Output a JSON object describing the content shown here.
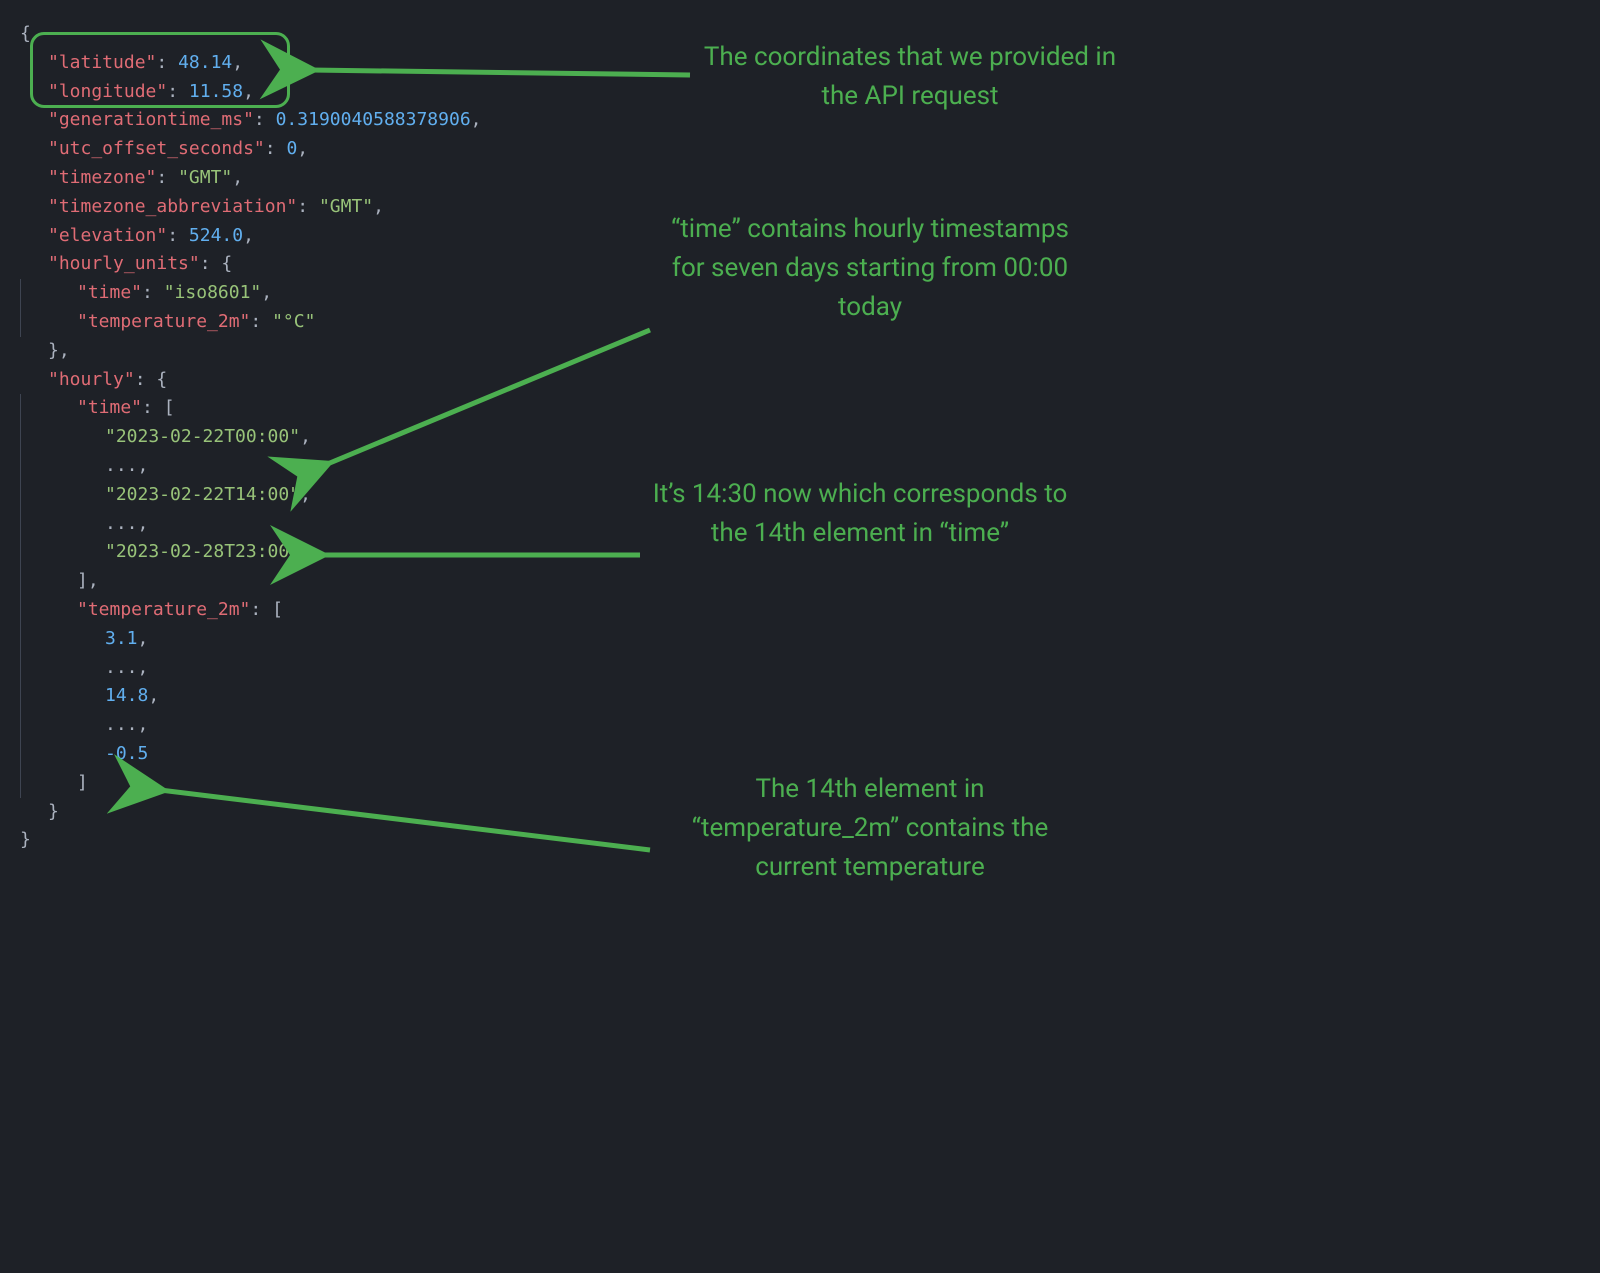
{
  "code": {
    "latitude_key": "\"latitude\"",
    "latitude_val": "48.14",
    "longitude_key": "\"longitude\"",
    "longitude_val": "11.58",
    "gentime_key": "\"generationtime_ms\"",
    "gentime_val": "0.3190040588378906",
    "utc_key": "\"utc_offset_seconds\"",
    "utc_val": "0",
    "tz_key": "\"timezone\"",
    "tz_val": "\"GMT\"",
    "tzabbr_key": "\"timezone_abbreviation\"",
    "tzabbr_val": "\"GMT\"",
    "elev_key": "\"elevation\"",
    "elev_val": "524.0",
    "hourly_units_key": "\"hourly_units\"",
    "hu_time_key": "\"time\"",
    "hu_time_val": "\"iso8601\"",
    "hu_temp_key": "\"temperature_2m\"",
    "hu_temp_val": "\"°C\"",
    "hourly_key": "\"hourly\"",
    "time_key": "\"time\"",
    "time_0": "\"2023-02-22T00:00\"",
    "ellipsis": "...",
    "time_14": "\"2023-02-22T14:00\"",
    "time_last": "\"2023-02-28T23:00\"",
    "temp_key": "\"temperature_2m\"",
    "temp_0": "3.1",
    "temp_14": "14.8",
    "temp_last": "-0.5"
  },
  "annotations": {
    "a1": "The coordinates that we provided in the API request",
    "a2": "“time” contains hourly timestamps for seven days starting from 00:00 today",
    "a3": "It’s 14:30 now which corresponds to the 14th element in “time”",
    "a4": "The 14th element in “temperature_2m” contains the current temperature"
  }
}
